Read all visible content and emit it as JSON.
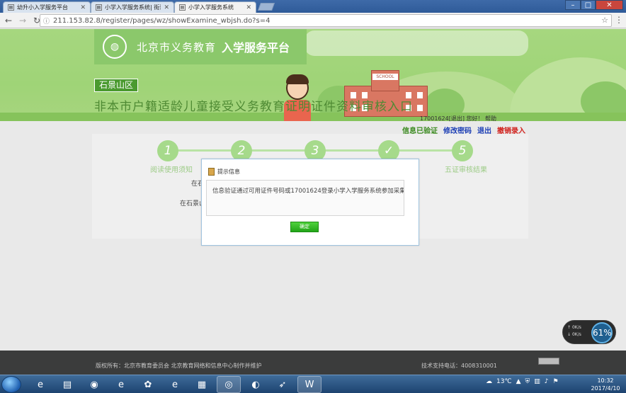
{
  "browser": {
    "tabs": [
      {
        "title": "幼升小入学服务平台",
        "active": false
      },
      {
        "title": "小学入学服务系统| 街道",
        "active": false
      },
      {
        "title": "小学入学服务系统",
        "active": true
      }
    ],
    "url": "211.153.82.8/register/pages/wz/showExamine_wbjsh.do?s=4"
  },
  "header": {
    "platform_name": "北京市义务教育",
    "platform_service": "入学服务平台",
    "district": "石景山区",
    "title": "非本市户籍适龄儿童接受义务教育证明证件资料审核入口",
    "school_sign": "SCHOOL"
  },
  "user_bar": {
    "greeting": "17001624[退出] 您好！ 帮助",
    "verified": "信息已验证",
    "change_password": "修改密码",
    "logout": "退出",
    "cancel_entry": "撤销录入"
  },
  "steps": [
    {
      "number": "1",
      "label": "阅读使用须知"
    },
    {
      "number": "2",
      "label": ""
    },
    {
      "number": "3",
      "label": ""
    },
    {
      "number": "✓",
      "label": ""
    },
    {
      "number": "5",
      "label": "五证审核结果"
    }
  ],
  "background_text": {
    "line1": "在石",
    "line2": "在石景山"
  },
  "modal": {
    "title": "提示信息",
    "message": "信息验证通过可用证件号码或17001624登录小学入学服务系统参加采集",
    "ok_label": "确定"
  },
  "footer": {
    "copyright": "版权所有：北京市教育委员会 北京教育网络和信息中心制作并维护",
    "support": "技术支持电话：4008310001"
  },
  "net_widget": {
    "up": "0K/s",
    "down": "0K/s",
    "percent": "61%"
  },
  "taskbar": {
    "apps": [
      {
        "icon": "ie-icon",
        "glyph": "e"
      },
      {
        "icon": "folder-icon",
        "glyph": "▤"
      },
      {
        "icon": "media-icon",
        "glyph": "◉"
      },
      {
        "icon": "ie-icon-2",
        "glyph": "e"
      },
      {
        "icon": "paw-icon",
        "glyph": "✿"
      },
      {
        "icon": "edge-icon",
        "glyph": "e"
      },
      {
        "icon": "tiles-icon",
        "glyph": "▦"
      },
      {
        "icon": "chrome-icon",
        "glyph": "◎"
      },
      {
        "icon": "firefox-icon",
        "glyph": "◐"
      },
      {
        "icon": "bird-icon",
        "glyph": "➶"
      },
      {
        "icon": "word-icon",
        "glyph": "W"
      }
    ],
    "weather": "13℃",
    "time": "10:32",
    "date": "2017/4/10"
  },
  "colors": {
    "banner_green": "#a6d77f",
    "accent_green": "#4a9a2f",
    "link_blue": "#1d3fb6",
    "link_red": "#d1201b"
  }
}
